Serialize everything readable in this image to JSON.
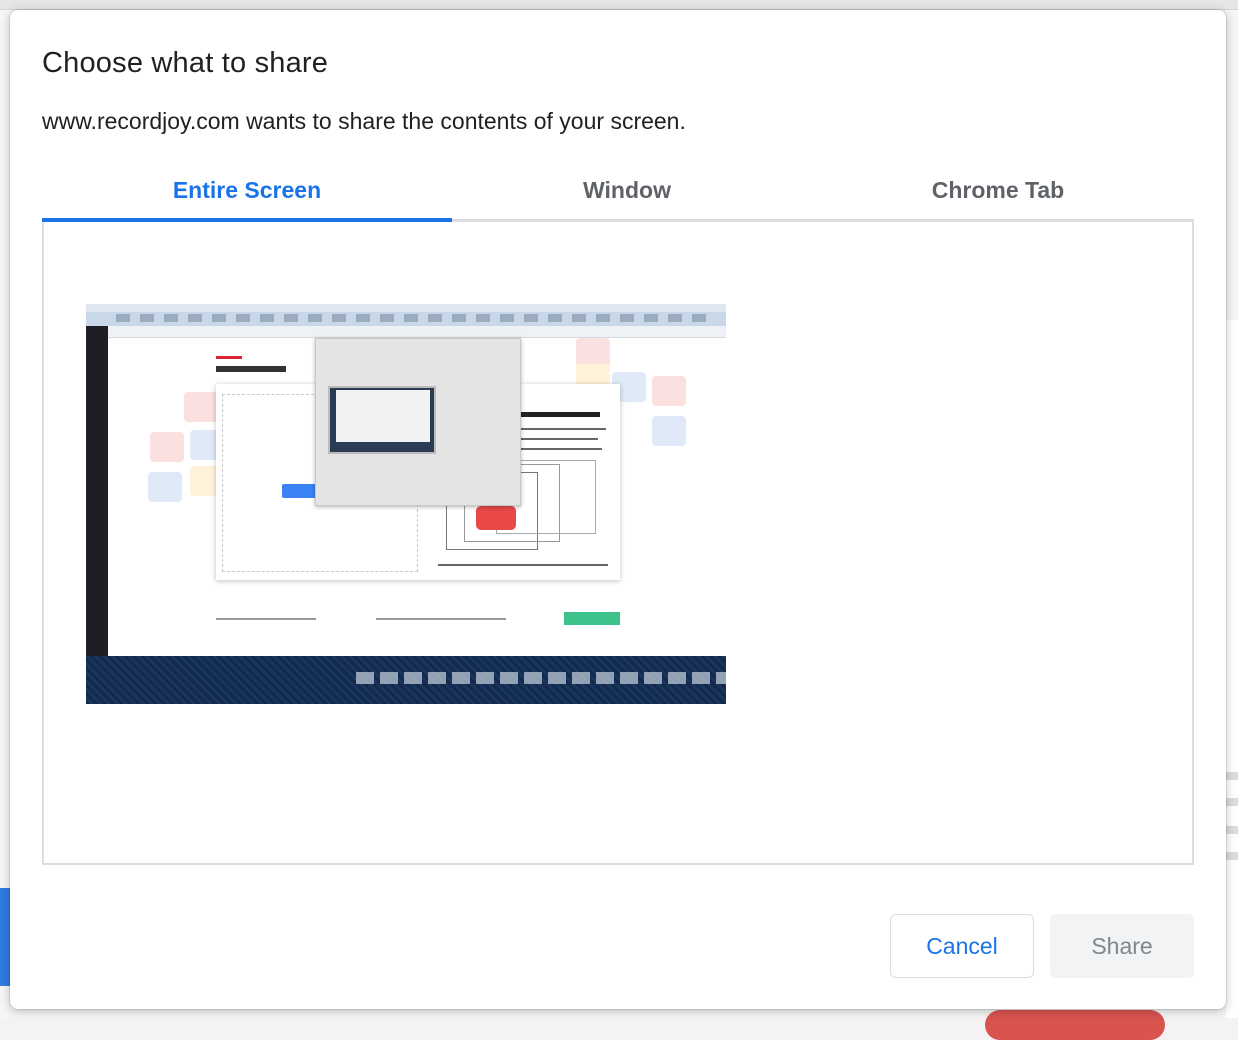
{
  "dialog": {
    "title": "Choose what to share",
    "subtitle": "www.recordjoy.com wants to share the contents of your screen."
  },
  "tabs": [
    {
      "label": "Entire Screen",
      "active": true
    },
    {
      "label": "Window",
      "active": false
    },
    {
      "label": "Chrome Tab",
      "active": false
    }
  ],
  "buttons": {
    "cancel_label": "Cancel",
    "share_label": "Share",
    "share_enabled": false
  },
  "colors": {
    "accent": "#1a73e8",
    "tab_inactive": "#5f6368",
    "share_disabled_bg": "#f1f3f4",
    "share_disabled_text": "#80868b"
  },
  "preview": {
    "icon": "screen-thumbnail"
  }
}
